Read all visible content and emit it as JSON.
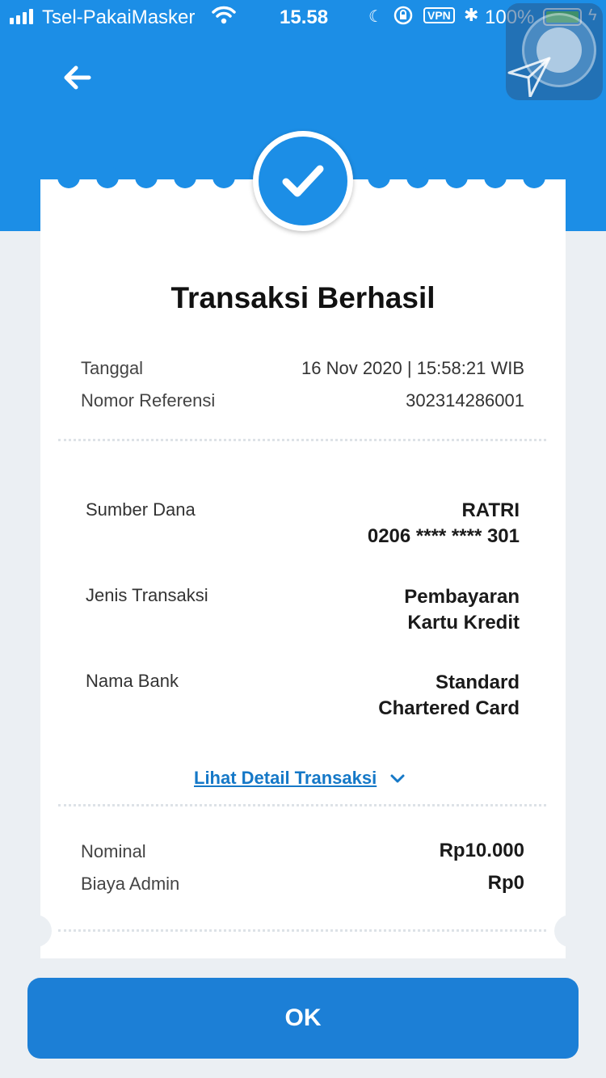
{
  "status_bar": {
    "carrier": "Tsel-PakaiMasker",
    "time": "15.58",
    "vpn": "VPN",
    "battery": "100%"
  },
  "header": {
    "back_icon": "arrow-left-icon",
    "accent_color": "#1c8ee6"
  },
  "receipt": {
    "title": "Transaksi Berhasil",
    "date_label": "Tanggal",
    "date_value": "16 Nov 2020 | 15:58:21 WIB",
    "ref_label": "Nomor Referensi",
    "ref_value": "302314286001",
    "source_label": "Sumber Dana",
    "source_name": "RATRI",
    "source_account": "0206 **** **** 301",
    "type_label": "Jenis Transaksi",
    "type_line1": "Pembayaran",
    "type_line2": "Kartu Kredit",
    "bank_label": "Nama Bank",
    "bank_line1": "Standard",
    "bank_line2": "Chartered Card",
    "detail_link": "Lihat Detail Transaksi",
    "nominal_label": "Nominal",
    "nominal_value": "Rp10.000",
    "admin_label": "Biaya Admin",
    "admin_value": "Rp0"
  },
  "actions": {
    "ok_label": "OK"
  }
}
